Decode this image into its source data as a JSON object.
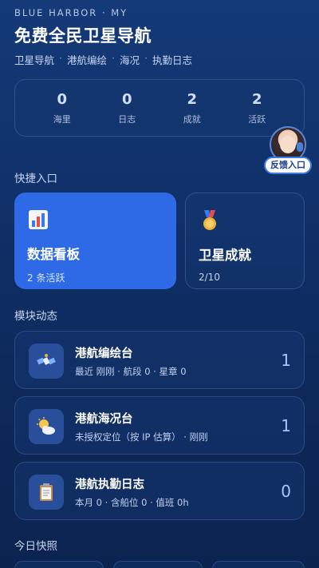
{
  "header": {
    "brand": "BLUE HARBOR · MY",
    "title": "免费全民卫星导航",
    "subnav": [
      "卫星导航",
      "港航编绘",
      "海况",
      "执勤日志"
    ]
  },
  "stats": [
    {
      "value": "0",
      "label": "海里"
    },
    {
      "value": "0",
      "label": "日志"
    },
    {
      "value": "2",
      "label": "成就"
    },
    {
      "value": "2",
      "label": "活跃"
    }
  ],
  "feedback": {
    "label": "反馈入口"
  },
  "quick": {
    "title": "快捷入口",
    "cards": [
      {
        "title": "数据看板",
        "sub": "2 条活跃",
        "icon": "bar-chart-icon"
      },
      {
        "title": "卫星成就",
        "sub": "2/10",
        "icon": "medal-icon"
      }
    ]
  },
  "modules": {
    "title": "模块动态",
    "items": [
      {
        "title": "港航编绘台",
        "sub": "最近 刚刚 · 航段 0 · 星章 0",
        "count": "1",
        "icon": "satellite-icon"
      },
      {
        "title": "港航海况台",
        "sub": "未授权定位（按 IP 估算） · 刚刚",
        "count": "1",
        "icon": "weather-icon"
      },
      {
        "title": "港航执勤日志",
        "sub": "本月 0 · 含船位 0 · 值班 0h",
        "count": "0",
        "icon": "clipboard-icon"
      }
    ]
  },
  "today": {
    "title": "今日快照"
  }
}
